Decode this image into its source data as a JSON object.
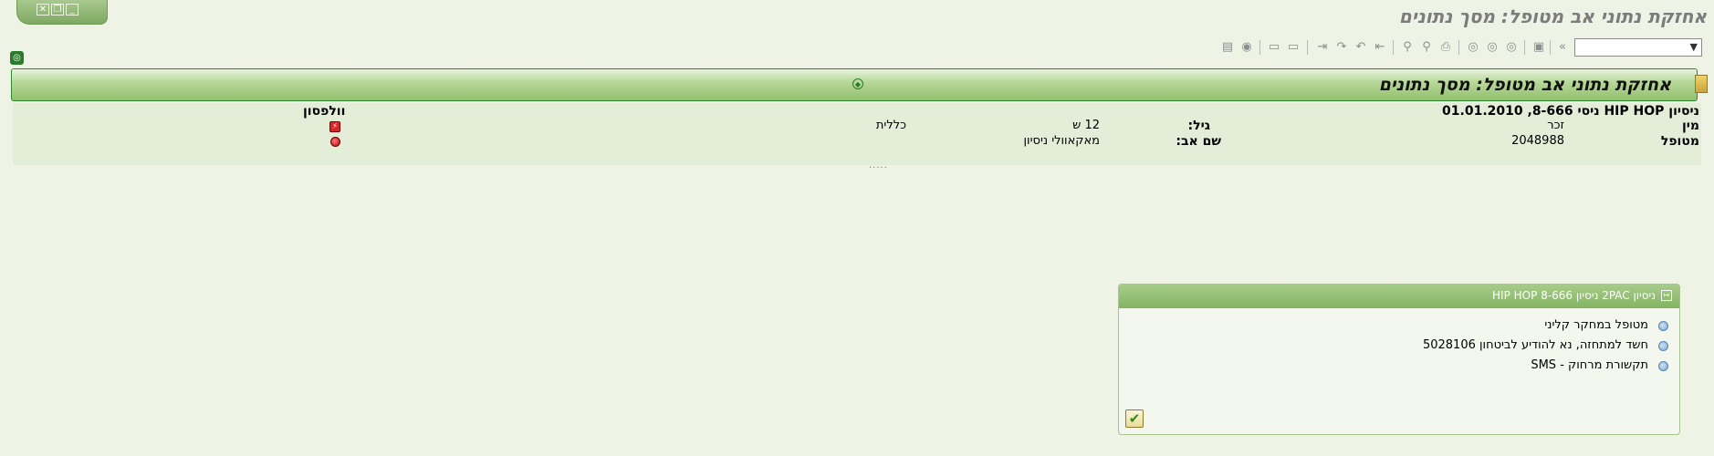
{
  "window": {
    "title": "אחזקת נתוני אב מטופל: מסך נתונים",
    "controls": [
      "close-icon",
      "restore-icon",
      "minimize-icon"
    ]
  },
  "toolbar": {
    "command_field_value": "",
    "icons": [
      "save-icon",
      "back-icon",
      "exit-icon",
      "cancel-icon",
      "print-icon",
      "find-icon",
      "find-next-icon",
      "first-page-icon",
      "prev-page-icon",
      "next-page-icon",
      "last-page-icon",
      "new-session-icon",
      "shortcut-icon",
      "help-icon",
      "layout-icon"
    ]
  },
  "banner": {
    "title": "אחזקת נתוני אב מטופל: מסך נתונים"
  },
  "patient": {
    "name": "ניסיון HIP HOP ניסי 8-666, 01.01.2010",
    "surname": "וולפסון",
    "gender_label": "מין",
    "gender_value": "זכר",
    "age_label": "גיל:",
    "age_value": "12 ש",
    "insurer_label": "כללית",
    "patient_label": "מטופל",
    "patient_number": "2048988",
    "father_label": "שם אב:",
    "father_value": "מאקאוולי ניסיון",
    "grip": "....."
  },
  "popup": {
    "title": "ניסיון 2PAC ניסיון 8-666 HIP HOP",
    "items": [
      "מטופל במחקר קליני",
      "חשד למתחזה, נא להודיע לביטחון 5028106",
      "תקשורת מרחוק - SMS"
    ],
    "ok_icon": "checkmark-icon"
  },
  "colors": {
    "banner_green": "#92c06c",
    "background": "#eef3e6",
    "alert_red": "#d62828"
  }
}
